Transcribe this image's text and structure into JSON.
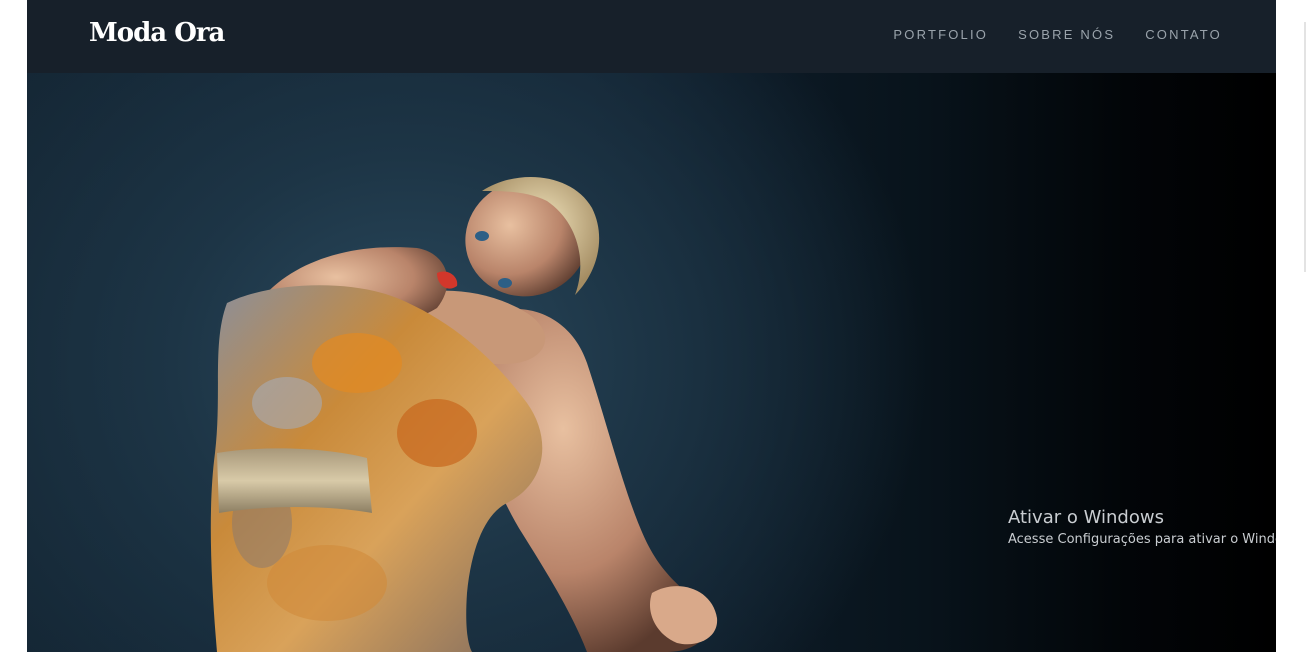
{
  "navbar": {
    "brand": "Moda Ora",
    "links": [
      "PORTFOLIO",
      "SOBRE NÓS",
      "CONTATO"
    ]
  },
  "hero": {
    "image": "fashion-model-photo"
  },
  "watermark": {
    "title": "Ativar o Windows",
    "subtitle": "Acesse Configurações para ativar o Windows."
  },
  "colors": {
    "navbar_bg": "#17202a",
    "nav_link": "#9aa3ab",
    "brand": "#ffffff"
  }
}
